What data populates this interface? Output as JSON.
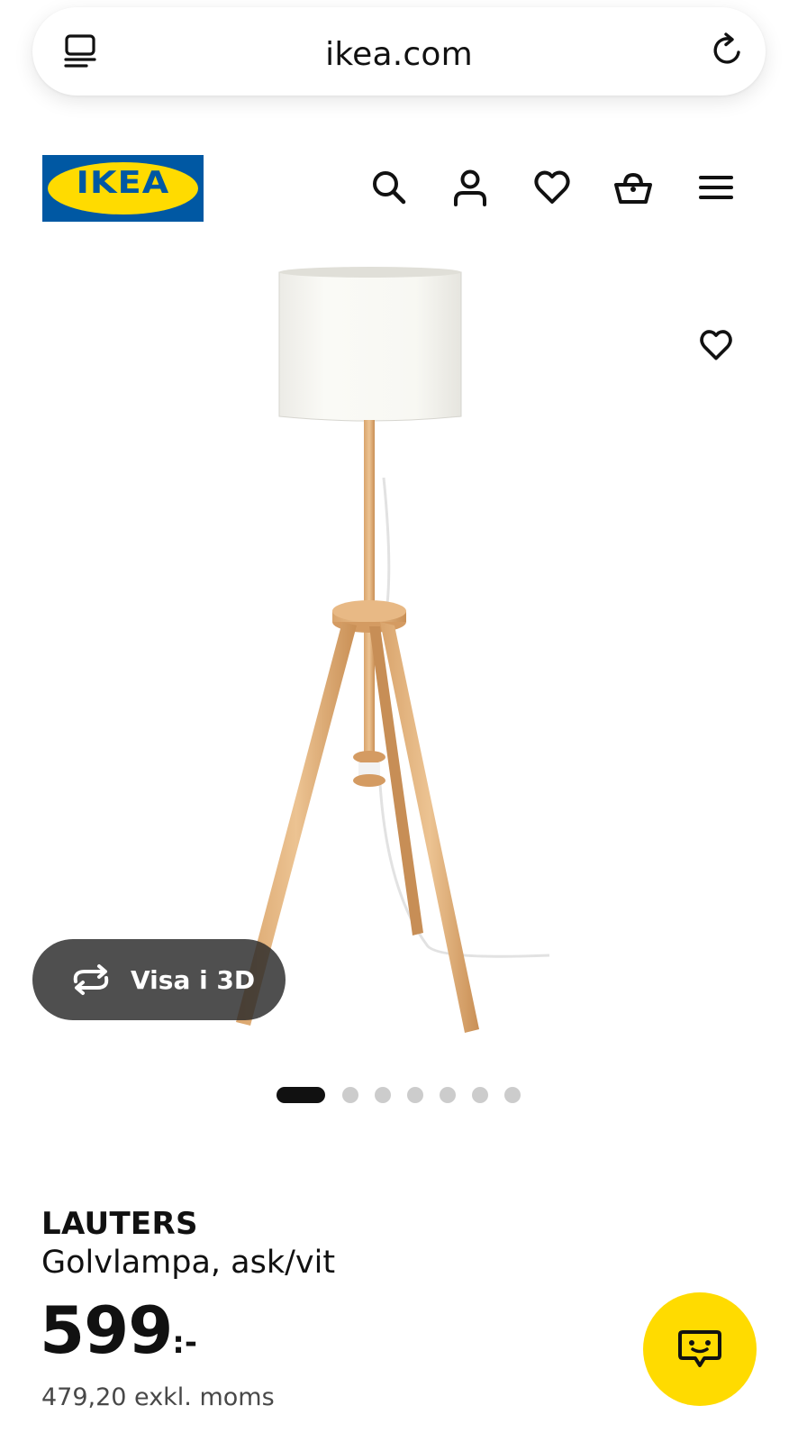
{
  "browser": {
    "url": "ikea.com",
    "tabs_icon": "tabs-icon",
    "reload_icon": "reload-icon"
  },
  "header": {
    "logo_text": "IKEA",
    "icons": [
      "search-icon",
      "user-icon",
      "heart-icon",
      "basket-icon",
      "menu-icon"
    ]
  },
  "gallery": {
    "view_3d_label": "Visa i 3D",
    "image_count": 7,
    "active_index": 0
  },
  "product": {
    "name": "LAUTERS",
    "description": "Golvlampa, ask/vit",
    "price_integer": "599",
    "price_suffix": ":-",
    "price_excl_vat": "479,20 exkl. moms"
  },
  "colors": {
    "ikea_blue": "#0058a3",
    "ikea_yellow": "#ffdb00"
  }
}
